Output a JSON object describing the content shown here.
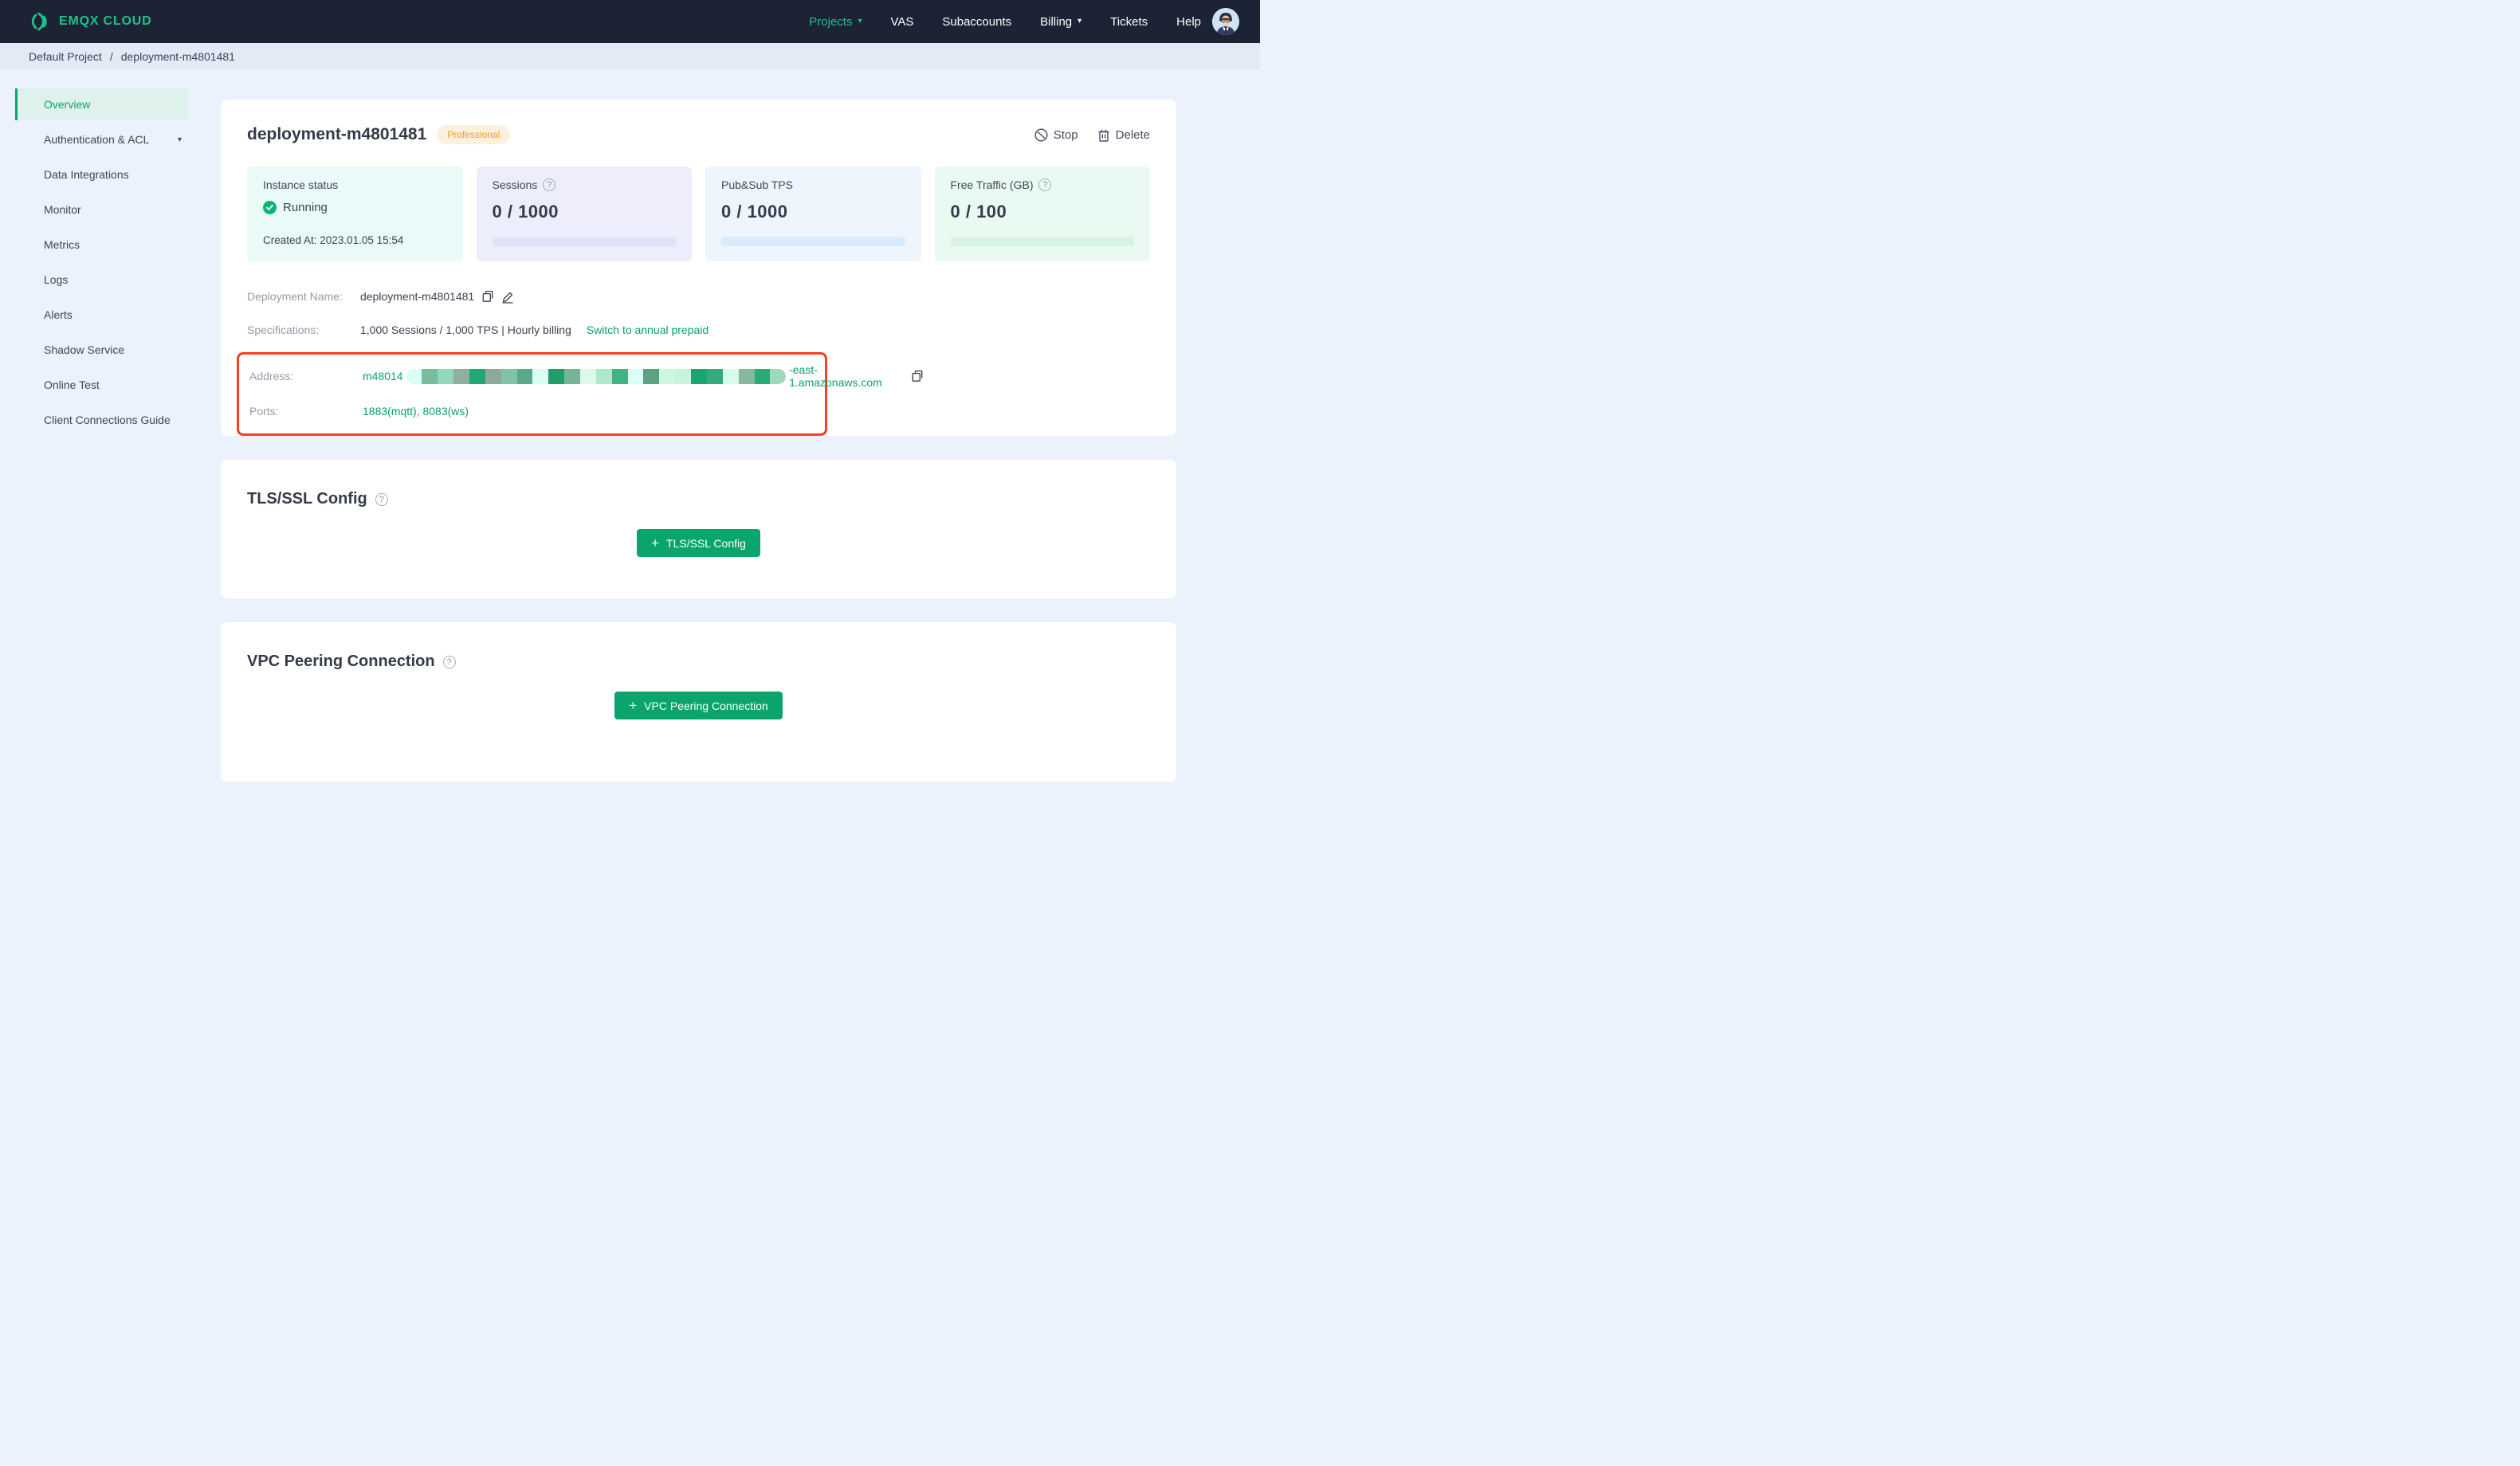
{
  "topbar": {
    "brand": "EMQX CLOUD",
    "nav": [
      {
        "label": "Projects",
        "active": true,
        "caret": true
      },
      {
        "label": "VAS",
        "active": false,
        "caret": false
      },
      {
        "label": "Subaccounts",
        "active": false,
        "caret": false
      },
      {
        "label": "Billing",
        "active": false,
        "caret": true
      },
      {
        "label": "Tickets",
        "active": false,
        "caret": false
      },
      {
        "label": "Help",
        "active": false,
        "caret": false
      }
    ]
  },
  "breadcrumb": {
    "project": "Default Project",
    "separator": "/",
    "deployment": "deployment-m4801481"
  },
  "sidebar": {
    "items": [
      {
        "label": "Overview",
        "active": true,
        "caret": false
      },
      {
        "label": "Authentication & ACL",
        "active": false,
        "caret": true
      },
      {
        "label": "Data Integrations",
        "active": false,
        "caret": false
      },
      {
        "label": "Monitor",
        "active": false,
        "caret": false
      },
      {
        "label": "Metrics",
        "active": false,
        "caret": false
      },
      {
        "label": "Logs",
        "active": false,
        "caret": false
      },
      {
        "label": "Alerts",
        "active": false,
        "caret": false
      },
      {
        "label": "Shadow Service",
        "active": false,
        "caret": false
      },
      {
        "label": "Online Test",
        "active": false,
        "caret": false
      },
      {
        "label": "Client Connections Guide",
        "active": false,
        "caret": false
      }
    ]
  },
  "overview": {
    "title": "deployment-m4801481",
    "plan_badge": "Professional",
    "actions": {
      "stop": "Stop",
      "delete": "Delete"
    },
    "stats": [
      {
        "kind": "status",
        "theme": "cyan",
        "label": "Instance status",
        "status": "Running",
        "created": "Created At: 2023.01.05 15:54"
      },
      {
        "kind": "metric",
        "theme": "purple",
        "label": "Sessions",
        "help": true,
        "value": "0 / 1000",
        "bar": "purple"
      },
      {
        "kind": "metric",
        "theme": "blue",
        "label": "Pub&Sub TPS",
        "help": false,
        "value": "0 / 1000",
        "bar": "blue"
      },
      {
        "kind": "metric",
        "theme": "green",
        "label": "Free Traffic (GB)",
        "help": true,
        "value": "0 / 100",
        "bar": "green"
      }
    ],
    "details": {
      "deployment_name_label": "Deployment Name:",
      "deployment_name": "deployment-m4801481",
      "specifications_label": "Specifications:",
      "specifications": "1,000 Sessions / 1,000 TPS | Hourly billing",
      "switch_link": "Switch to annual prepaid",
      "address_label": "Address:",
      "address_prefix": "m48014",
      "address_suffix": "-east-1.amazonaws.com",
      "ports_label": "Ports:",
      "ports": "1883(mqtt), 8083(ws)"
    }
  },
  "tls": {
    "title": "TLS/SSL Config",
    "button_label": "TLS/SSL Config"
  },
  "vpc": {
    "title": "VPC Peering Connection",
    "button_label": "VPC Peering Connection"
  },
  "icons": {
    "caret_down": "▾",
    "plus": "+",
    "help": "?"
  },
  "colors": {
    "topbar_bg": "#1c2334",
    "accent_green": "#0aa56d",
    "nav_green": "#1fc18a",
    "badge_orange": "#f59b25",
    "annotation_red": "#f7401f"
  },
  "redaction_palette": [
    "#dbfff3",
    "#79bb9f",
    "#90d9bc",
    "#8fafa0",
    "#23a873",
    "#8caa9c",
    "#80c3a8",
    "#58a88a",
    "#d9fff2",
    "#1f9e6a",
    "#74b59a",
    "#def9ea",
    "#ace8cc",
    "#40b385",
    "#dcfff5",
    "#5ba183",
    "#ccf7e0",
    "#c5f5da",
    "#1da470",
    "#33ab7c",
    "#d9fbe9",
    "#88b7a0",
    "#2aaa76",
    "#9ed9bd"
  ]
}
